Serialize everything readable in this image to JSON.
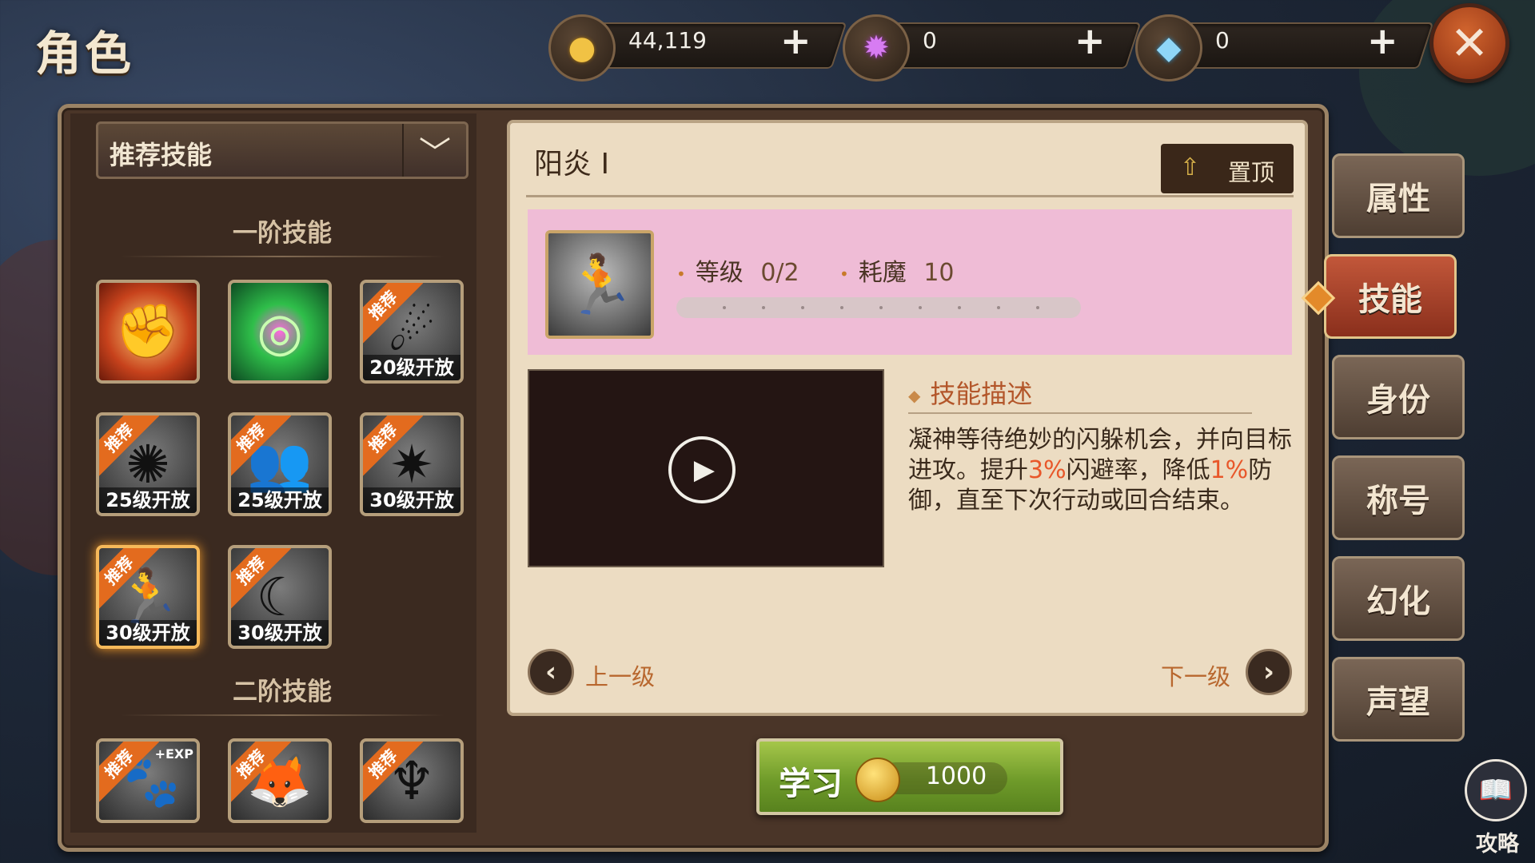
{
  "page": {
    "title": "角色"
  },
  "currencies": [
    {
      "icon": "gold-coin-icon",
      "value": "44,119",
      "add_label": "+"
    },
    {
      "icon": "purple-orb-icon",
      "value": "0",
      "add_label": "+"
    },
    {
      "icon": "diamond-icon",
      "value": "0",
      "add_label": "+"
    }
  ],
  "close_label": "✕",
  "skill_list": {
    "filter": {
      "selected": "推荐技能",
      "chevron": "﹀"
    },
    "tier1_title": "一阶技能",
    "tier2_title": "二阶技能",
    "badge_text": "推荐",
    "tier1": [
      {
        "name": "fist-fire",
        "recommended": false,
        "lock_text": "",
        "selected": false
      },
      {
        "name": "green-vortex",
        "recommended": false,
        "lock_text": "",
        "selected": false
      },
      {
        "name": "comet-strike",
        "recommended": true,
        "lock_text": "20级开放",
        "selected": false
      },
      {
        "name": "shatter-burst",
        "recommended": true,
        "lock_text": "25级开放",
        "selected": false
      },
      {
        "name": "twin-silhouette",
        "recommended": true,
        "lock_text": "25级开放",
        "selected": false
      },
      {
        "name": "feather-slash",
        "recommended": true,
        "lock_text": "30级开放",
        "selected": false
      },
      {
        "name": "yang-yan",
        "recommended": true,
        "lock_text": "30级开放",
        "selected": true
      },
      {
        "name": "crescent-blade",
        "recommended": true,
        "lock_text": "30级开放",
        "selected": false
      }
    ],
    "tier2": [
      {
        "name": "beast-exp",
        "recommended": true,
        "extra": "+EXP"
      },
      {
        "name": "fox-spirit",
        "recommended": true,
        "extra": ""
      },
      {
        "name": "winged-figure",
        "recommended": true,
        "extra": ""
      }
    ]
  },
  "detail": {
    "skill_name": "阳炎 Ⅰ",
    "pin_label": "置顶",
    "level_label": "等级",
    "level_value": "0/2",
    "mana_label": "耗魔",
    "mana_value": "10",
    "level_progress": 0,
    "desc_title": "技能描述",
    "desc": {
      "p1": "凝神等待绝妙的闪躲机会，并向目标进攻。提升",
      "hl1": "3%",
      "p2": "闪避率，降低",
      "hl2": "1%",
      "p3": "防御，直至下次行动或回合结束。"
    },
    "prev_label": "上一级",
    "next_label": "下一级"
  },
  "learn": {
    "label": "学习",
    "cost": "1000"
  },
  "tabs": [
    {
      "label": "属性",
      "active": false
    },
    {
      "label": "技能",
      "active": true
    },
    {
      "label": "身份",
      "active": false
    },
    {
      "label": "称号",
      "active": false
    },
    {
      "label": "幻化",
      "active": false
    },
    {
      "label": "声望",
      "active": false
    }
  ],
  "guide_label": "攻略",
  "colors": {
    "accent_orange": "#e36b1e",
    "highlight": "#e8572a",
    "info_bg": "#efbcd6",
    "learn_green": "#6f9b2a"
  }
}
